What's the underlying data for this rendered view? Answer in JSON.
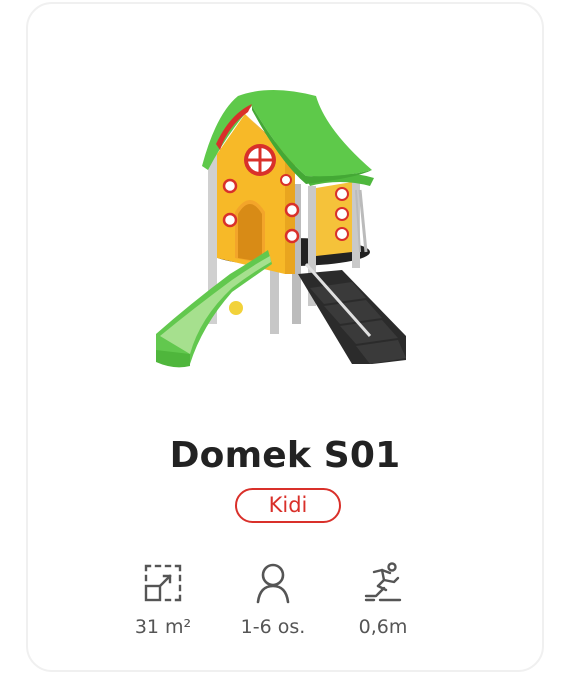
{
  "product": {
    "name": "Domek S01",
    "category_badge": "Kidi",
    "image_subject": "playhouse-with-slide",
    "colors": {
      "roof_green": "#5ec94a",
      "wall_yellow": "#f5b82a",
      "accent_red": "#d9302a",
      "stairs_dark": "#2e2e2e",
      "badge": "#d9302a"
    }
  },
  "specs": [
    {
      "icon": "area-icon",
      "label": "31 m²"
    },
    {
      "icon": "person-icon",
      "label": "1-6 os."
    },
    {
      "icon": "fall-height-icon",
      "label": "0,6m"
    }
  ]
}
